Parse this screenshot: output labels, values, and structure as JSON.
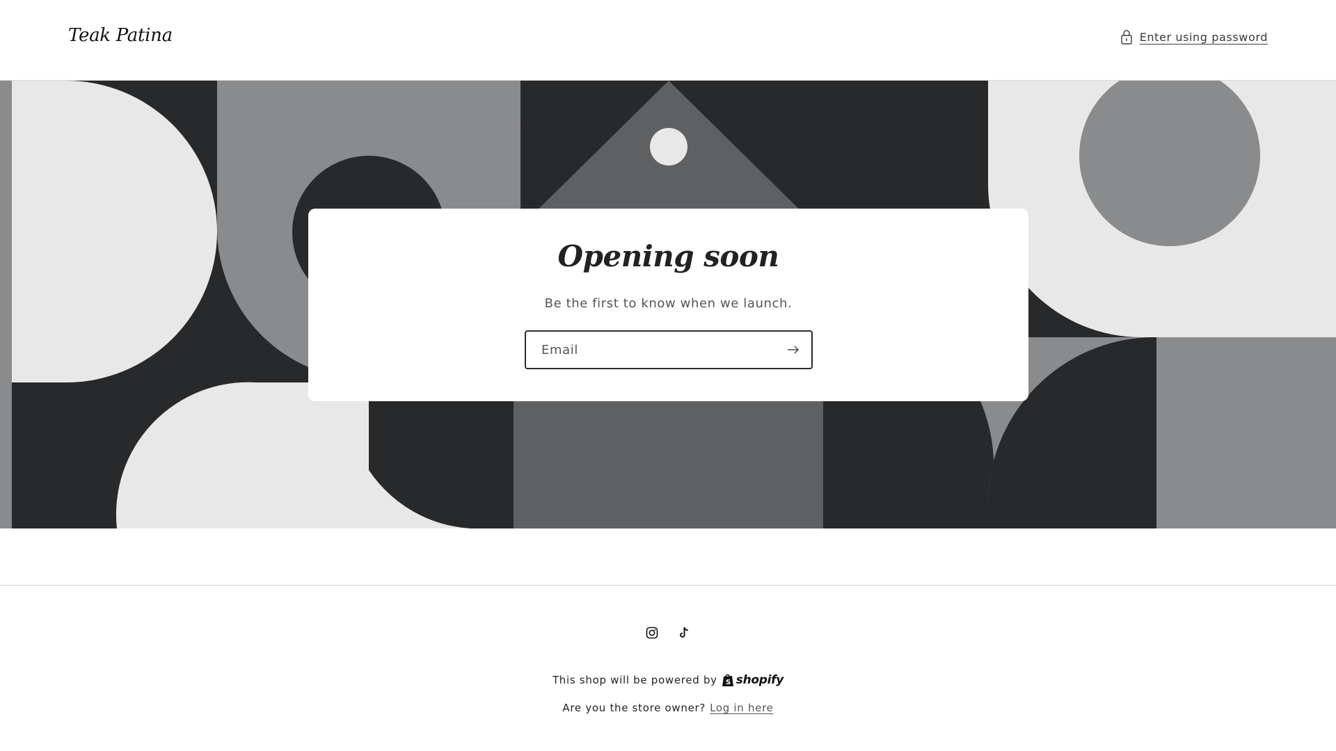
{
  "header": {
    "store_title": "Teak Patina",
    "password_link_label": "Enter using password"
  },
  "newsletter": {
    "title": "Opening soon",
    "subtitle": "Be the first to know when we launch.",
    "email_placeholder": "Email"
  },
  "footer": {
    "social_icons": [
      "instagram-icon",
      "tiktok-icon"
    ],
    "powered_by_text": "This shop will be powered by",
    "shopify_brand": "shopify",
    "owner_prompt": "Are you the store owner?",
    "login_link_label": "Log in here"
  },
  "colors": {
    "background": "#ffffff",
    "text": "#121212",
    "banner_dark": "#28292b",
    "banner_mid": "#8a8b8c",
    "banner_gray": "#5f6062",
    "banner_light": "#e8e8e8"
  }
}
